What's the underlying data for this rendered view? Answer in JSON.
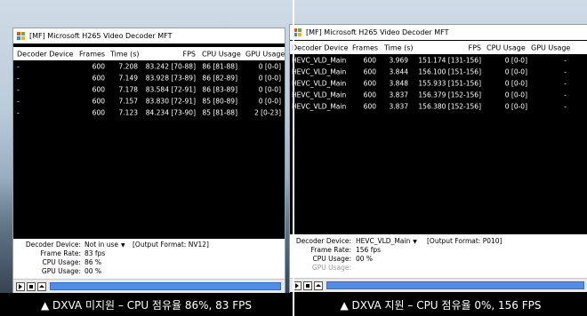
{
  "left": {
    "title": "[MF]  Microsoft H265 Video Decoder MFT",
    "columns": [
      "Decoder Device",
      "Frames",
      "Time (s)",
      "FPS",
      "CPU Usage",
      "GPU Usage"
    ],
    "rows": [
      {
        "device": "-",
        "frames": "600",
        "time": "7.208",
        "fps": "83.242 [70-88]",
        "cpu": "86 [81-88]",
        "gpu": "0 [0-0]"
      },
      {
        "device": "-",
        "frames": "600",
        "time": "7.149",
        "fps": "83.928 [73-89]",
        "cpu": "86 [82-89]",
        "gpu": "0 [0-0]"
      },
      {
        "device": "-",
        "frames": "600",
        "time": "7.178",
        "fps": "83.584 [72-91]",
        "cpu": "86 [83-89]",
        "gpu": "0 [0-0]"
      },
      {
        "device": "-",
        "frames": "600",
        "time": "7.157",
        "fps": "83.830 [72-91]",
        "cpu": "85 [80-89]",
        "gpu": "0 [0-0]"
      },
      {
        "device": "-",
        "frames": "600",
        "time": "7.123",
        "fps": "84.234 [73-90]",
        "cpu": "85 [81-88]",
        "gpu": "2 [0-23]"
      }
    ],
    "info": {
      "decoder_device_label": "Decoder Device:",
      "decoder_device_value": "Not in use",
      "output_format": "[Output Format: NV12]",
      "frame_rate_label": "Frame Rate:",
      "frame_rate_value": "83 fps",
      "cpu_usage_label": "CPU Usage:",
      "cpu_usage_value": "86 %",
      "gpu_usage_label": "GPU Usage:",
      "gpu_usage_value": "00 %"
    },
    "caption": "▲ DXVA 미지원 – CPU 점유율 86%, 83 FPS"
  },
  "right": {
    "title": "[MF]  Microsoft H265 Video Decoder MFT",
    "columns": [
      "Decoder Device",
      "Frames",
      "Time (s)",
      "FPS",
      "CPU Usage",
      "GPU Usage"
    ],
    "rows": [
      {
        "device": "HEVC_VLD_Main",
        "frames": "600",
        "time": "3.969",
        "fps": "151.174 [131-156]",
        "cpu": "0 [0-0]",
        "gpu": "-"
      },
      {
        "device": "HEVC_VLD_Main",
        "frames": "600",
        "time": "3.844",
        "fps": "156.100 [151-156]",
        "cpu": "0 [0-0]",
        "gpu": "-"
      },
      {
        "device": "HEVC_VLD_Main",
        "frames": "600",
        "time": "3.848",
        "fps": "155.933 [151-156]",
        "cpu": "0 [0-0]",
        "gpu": "-"
      },
      {
        "device": "HEVC_VLD_Main",
        "frames": "600",
        "time": "3.837",
        "fps": "156.379 [152-156]",
        "cpu": "0 [0-0]",
        "gpu": "-"
      },
      {
        "device": "HEVC_VLD_Main",
        "frames": "600",
        "time": "3.837",
        "fps": "156.380 [152-156]",
        "cpu": "0 [0-0]",
        "gpu": "-"
      }
    ],
    "info": {
      "decoder_device_label": "Decoder Device:",
      "decoder_device_value": "HEVC_VLD_Main",
      "output_format": "[Output Format: P010]",
      "frame_rate_label": "Frame Rate:",
      "frame_rate_value": "156 fps",
      "cpu_usage_label": "CPU Usage:",
      "cpu_usage_value": "00 %",
      "gpu_usage_label": "GPU Usage:",
      "gpu_usage_value": ""
    },
    "caption": "▲ DXVA 지원 – CPU 점유율 0%, 156 FPS"
  },
  "icons": {
    "app_icon": "windows-flag-icon",
    "play": "play-icon",
    "stop": "stop-icon",
    "eject": "eject-icon"
  },
  "colors": {
    "seek_bar": "#4f8de6",
    "window_bg": "#000000"
  }
}
